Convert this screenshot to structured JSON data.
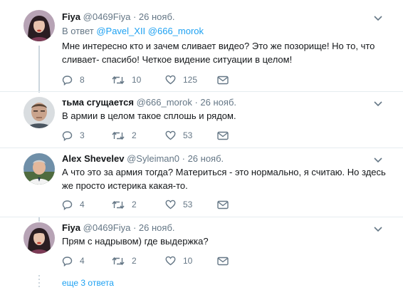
{
  "tweets": [
    {
      "name": "Fiya",
      "handle": "@0469Fiya",
      "dot": "·",
      "time": "26 нояб.",
      "reply_prefix": "В ответ",
      "reply_users": [
        "@Pavel_XII",
        "@666_morok"
      ],
      "text": "Мне интересно кто и зачем сливает видео? Это же позорище! Но то, что сливает- спасибо! Четкое видение ситуации в целом!",
      "replies": "8",
      "retweets": "10",
      "likes": "125",
      "avatar": "woman-avatar"
    },
    {
      "name": "тьма сгущается",
      "handle": "@666_morok",
      "dot": "·",
      "time": "26 нояб.",
      "text": "В армии в целом такое сплошь и рядом.",
      "replies": "3",
      "retweets": "2",
      "likes": "53",
      "avatar": "man-avatar"
    },
    {
      "name": "Alex Shevelev",
      "handle": "@Syleiman0",
      "dot": "·",
      "time": "26 нояб.",
      "text": "А что это за армия тогда? Материться - это нормально, я считаю. Но здесь же просто истерика какая-то.",
      "replies": "4",
      "retweets": "2",
      "likes": "53",
      "avatar": "elder-avatar"
    },
    {
      "name": "Fiya",
      "handle": "@0469Fiya",
      "dot": "·",
      "time": "26 нояб.",
      "text": "Прям с надрывом) где выдержка?",
      "replies": "4",
      "retweets": "2",
      "likes": "10",
      "avatar": "woman-avatar"
    }
  ],
  "more_replies": "еще 3 ответа",
  "colors": {
    "link": "#1da1f2",
    "muted": "#657786",
    "text": "#14171a",
    "thread_line": "#ccd6dd"
  }
}
